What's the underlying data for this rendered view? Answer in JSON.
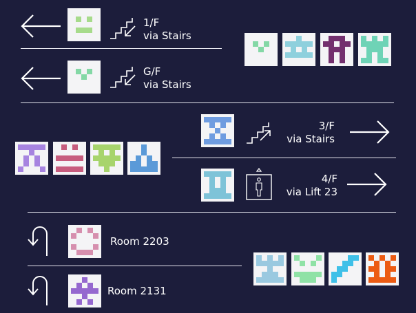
{
  "wayfinding": {
    "rows": [
      {
        "floor": "1/F",
        "route": "via Stairs"
      },
      {
        "floor": "G/F",
        "route": "via Stairs"
      },
      {
        "floor": "3/F",
        "route": "via Stairs"
      },
      {
        "floor": "4/F",
        "route": "via Lift 23"
      },
      {
        "room": "Room 2203"
      },
      {
        "room": "Room 2131"
      }
    ]
  },
  "colors": {
    "background": "#1c1d3b",
    "text": "#ffffff",
    "tile_background": "#f4f4f6",
    "light_green": "#a7db8b",
    "mint": "#84d8a6",
    "sky": "#8fd0dd",
    "purple": "#73306e",
    "teal": "#6fd3b6",
    "lavender": "#a784e0",
    "rose": "#c75d7e",
    "lime": "#a7d46c",
    "blue": "#5b9ad8",
    "cornflower": "#6f9ce0",
    "cyan": "#7ec3d8",
    "pink": "#d68fae",
    "violet": "#9568cf",
    "powder": "#9ac9e0",
    "spring": "#8fe2a6",
    "aqua": "#3fc0e8",
    "orange": "#ec5b12"
  },
  "icons": {
    "left_arrow": "arrow-left-icon",
    "right_arrow": "arrow-right-icon",
    "stairs_down": "stairs-down-icon",
    "stairs_up": "stairs-up-icon",
    "lift": "lift-icon",
    "u_turn": "u-turn-icon"
  },
  "tiles": [
    {
      "name": "symbol-tile-1f",
      "color": "#a7db8b",
      "pattern": [
        "00000",
        "01010",
        "00000",
        "01110",
        "00000"
      ]
    },
    {
      "name": "symbol-tile-gf",
      "color": "#84d8a6",
      "pattern": [
        "00000",
        "01010",
        "00100",
        "00000",
        "00000"
      ]
    },
    {
      "name": "symbol-tile-3f",
      "color": "#6f9ce0",
      "pattern": [
        "11111",
        "01010",
        "00100",
        "01010",
        "11111"
      ]
    },
    {
      "name": "symbol-tile-4f",
      "color": "#7ec3d8",
      "pattern": [
        "11111",
        "01010",
        "01010",
        "01110",
        "11111"
      ]
    },
    {
      "name": "symbol-tile-room-2203",
      "color": "#d68fae",
      "pattern": [
        "01010",
        "10001",
        "00000",
        "10001",
        "01110"
      ]
    },
    {
      "name": "symbol-tile-room-2131",
      "color": "#9568cf",
      "pattern": [
        "00100",
        "01010",
        "11111",
        "00100",
        "01010"
      ]
    },
    {
      "name": "group-tile-a1",
      "color": "#84d8a6",
      "pattern": [
        "00000",
        "01010",
        "00100",
        "00000",
        "00000"
      ]
    },
    {
      "name": "group-tile-a2",
      "color": "#8fd0dd",
      "pattern": [
        "00100",
        "11111",
        "01010",
        "11111",
        "00000"
      ]
    },
    {
      "name": "group-tile-a3",
      "color": "#73306e",
      "pattern": [
        "01110",
        "11011",
        "01110",
        "01010",
        "01010"
      ]
    },
    {
      "name": "group-tile-a4",
      "color": "#6fd3b6",
      "pattern": [
        "10101",
        "11111",
        "01110",
        "01010",
        "11011"
      ]
    },
    {
      "name": "group-tile-b1",
      "color": "#a784e0",
      "pattern": [
        "11111",
        "00100",
        "01010",
        "01010",
        "10001"
      ]
    },
    {
      "name": "group-tile-b2",
      "color": "#c75d7e",
      "pattern": [
        "01010",
        "00000",
        "11111",
        "00000",
        "11111"
      ]
    },
    {
      "name": "group-tile-b3",
      "color": "#a7d46c",
      "pattern": [
        "11111",
        "01010",
        "11111",
        "01110",
        "00100"
      ]
    },
    {
      "name": "group-tile-b4",
      "color": "#5b9ad8",
      "pattern": [
        "00100",
        "00100",
        "01010",
        "11011",
        "11111"
      ]
    },
    {
      "name": "group-tile-c1",
      "color": "#9ac9e0",
      "pattern": [
        "10101",
        "11111",
        "00100",
        "01110",
        "11111"
      ]
    },
    {
      "name": "group-tile-c2",
      "color": "#8fe2a6",
      "pattern": [
        "10001",
        "01010",
        "00000",
        "11111",
        "01110"
      ]
    },
    {
      "name": "group-tile-c3",
      "color": "#3fc0e8",
      "pattern": [
        "00011",
        "00110",
        "01100",
        "11000",
        "10000"
      ]
    },
    {
      "name": "group-tile-c4",
      "color": "#ec5b12",
      "pattern": [
        "10101",
        "01010",
        "11011",
        "01010",
        "11111"
      ]
    }
  ]
}
